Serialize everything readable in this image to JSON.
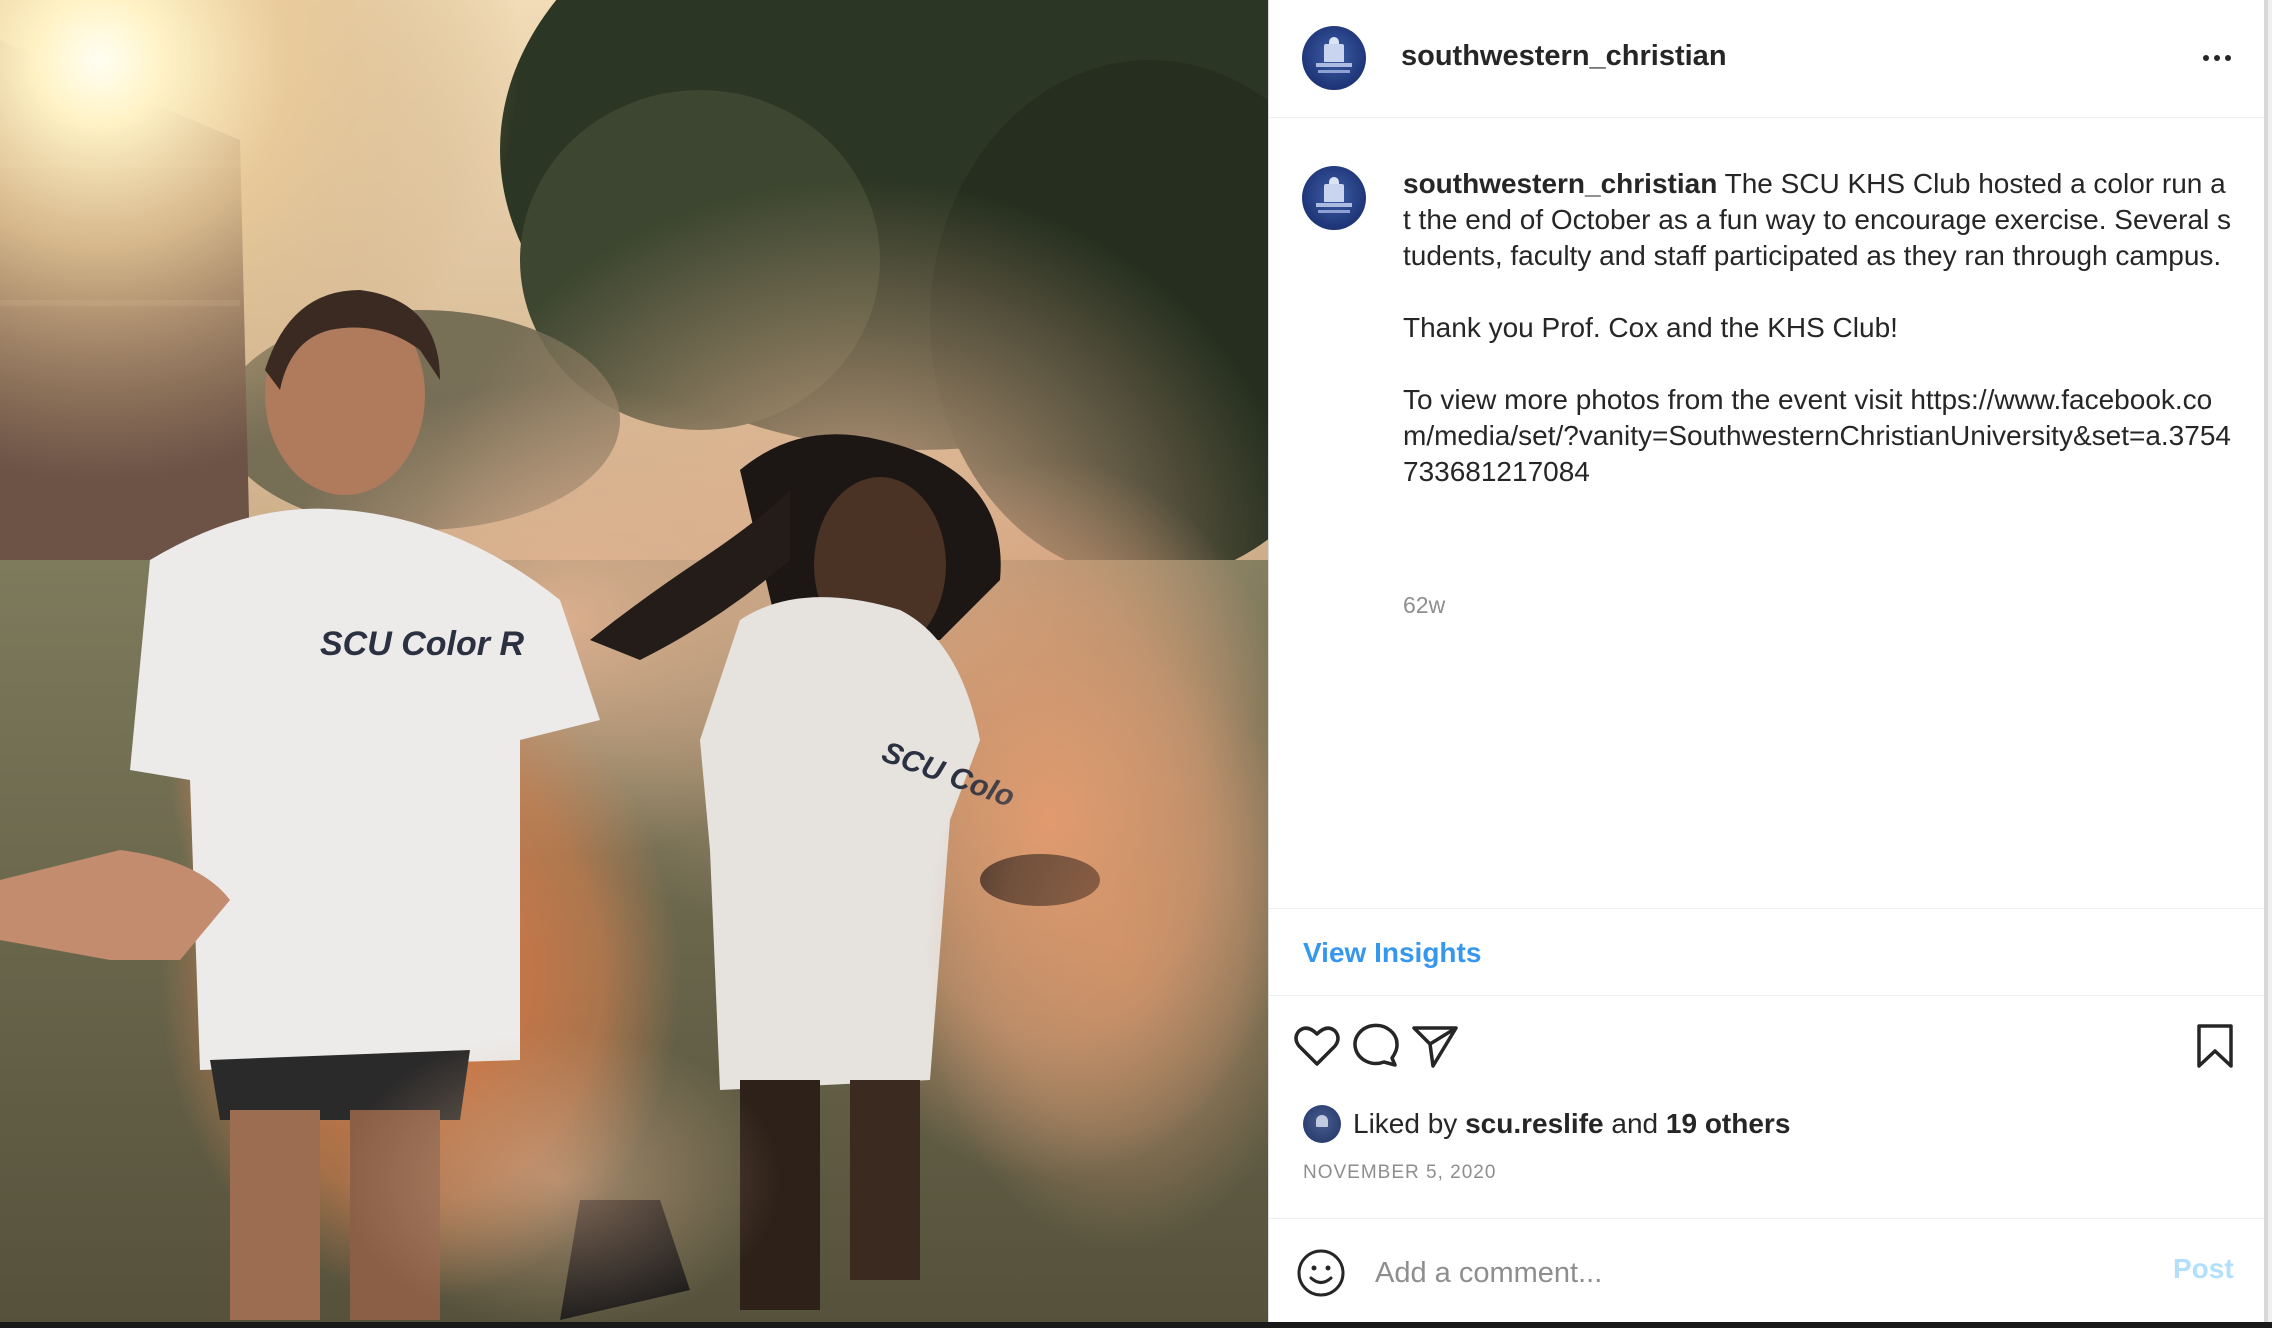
{
  "post": {
    "header": {
      "username": "southwestern_christian",
      "more_icon": "more-horizontal-icon"
    },
    "caption": {
      "username": "southwestern_christian",
      "text": " The SCU KHS Club hosted a color run at the end of October as a fun way to encourage exercise. Several students, faculty and staff participated as they ran through campus.\n\nThank you Prof. Cox and the KHS Club!\n\nTo view more photos from the event visit https://www.facebook.com/media/set/?vanity=SouthwesternChristianUniversity&set=a.3754733681217084",
      "age": "62w"
    },
    "insights": {
      "label": "View Insights",
      "color": "#3797ef"
    },
    "actions": {
      "icons": [
        "heart-icon",
        "comment-icon",
        "share-icon",
        "bookmark-icon"
      ]
    },
    "likes": {
      "prefix": "Liked by ",
      "user": "scu.reslife",
      "middle": " and ",
      "others": "19 others"
    },
    "date": "NOVEMBER 5, 2020",
    "comment_box": {
      "placeholder": "Add a comment...",
      "post_label": "Post",
      "emoji_icon": "emoji-smile-icon"
    },
    "photo": {
      "shirt_text_left": "SCU Color R",
      "shirt_text_right": "SCU Colo"
    }
  }
}
